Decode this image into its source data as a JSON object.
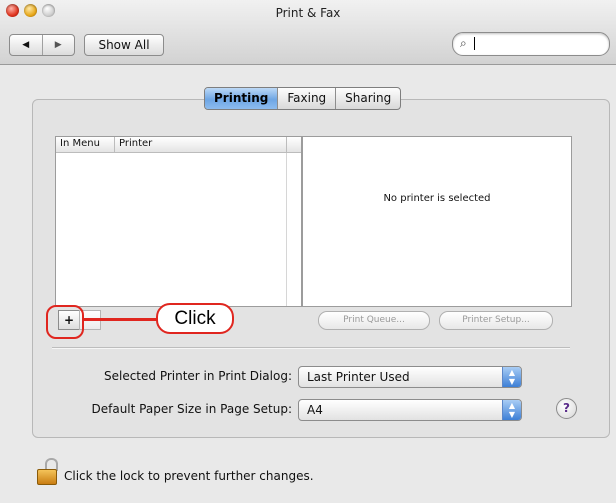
{
  "window": {
    "title": "Print & Fax"
  },
  "toolbar": {
    "back_icon": "◀",
    "forward_icon": "▶",
    "show_all_label": "Show All",
    "search_value": ""
  },
  "tabs": [
    {
      "label": "Printing",
      "active": true
    },
    {
      "label": "Faxing",
      "active": false
    },
    {
      "label": "Sharing",
      "active": false
    }
  ],
  "printer_list": {
    "columns": [
      "In Menu",
      "Printer"
    ],
    "rows": []
  },
  "info_panel": {
    "message": "No printer is selected"
  },
  "list_controls": {
    "add_label": "+",
    "remove_label": ""
  },
  "callout": {
    "label": "Click",
    "color": "#e0261f"
  },
  "actions": {
    "print_queue_label": "Print Queue...",
    "printer_setup_label": "Printer Setup..."
  },
  "settings": {
    "selected_printer_label": "Selected Printer in Print Dialog:",
    "selected_printer_value": "Last Printer Used",
    "paper_size_label": "Default Paper Size in Page Setup:",
    "paper_size_value": "A4"
  },
  "help": {
    "label": "?"
  },
  "footer": {
    "lock_text": "Click the lock to prevent further changes."
  },
  "colors": {
    "accent": "#3d7fd6",
    "tab_active": "#6ea6e4"
  }
}
